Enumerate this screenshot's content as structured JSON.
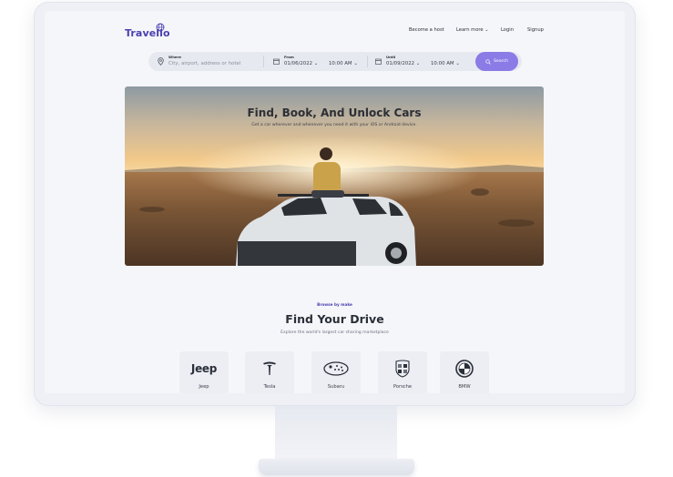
{
  "brand": {
    "name": "Travello"
  },
  "nav": {
    "become_host": "Become a host",
    "learn_more": "Learn more",
    "login": "Login",
    "signup": "Signup"
  },
  "search": {
    "where_label": "Where",
    "where_placeholder": "City, airport, address or hotel",
    "from_label": "From",
    "from_date": "01/06/2022",
    "from_time": "10:00 AM",
    "until_label": "Until",
    "until_date": "01/09/2022",
    "until_time": "10:00 AM",
    "button": "Search"
  },
  "hero": {
    "title": "Find, Book, And Unlock Cars",
    "subtitle": "Get a car wherever and whenever you need it with your iOS or Android device."
  },
  "browse": {
    "eyebrow": "Browse by make",
    "title": "Find Your Drive",
    "subtitle": "Explore the world's largest car sharing marketplace",
    "makes": [
      {
        "name": "Jeep",
        "icon": "jeep-logo"
      },
      {
        "name": "Tesla",
        "icon": "tesla-logo"
      },
      {
        "name": "Subaru",
        "icon": "subaru-logo"
      },
      {
        "name": "Porsche",
        "icon": "porsche-logo"
      },
      {
        "name": "BMW",
        "icon": "bmw-logo"
      }
    ]
  },
  "colors": {
    "brand": "#4a3fb0",
    "accent": "#8a7be6",
    "screen_bg": "#f5f6f9"
  }
}
